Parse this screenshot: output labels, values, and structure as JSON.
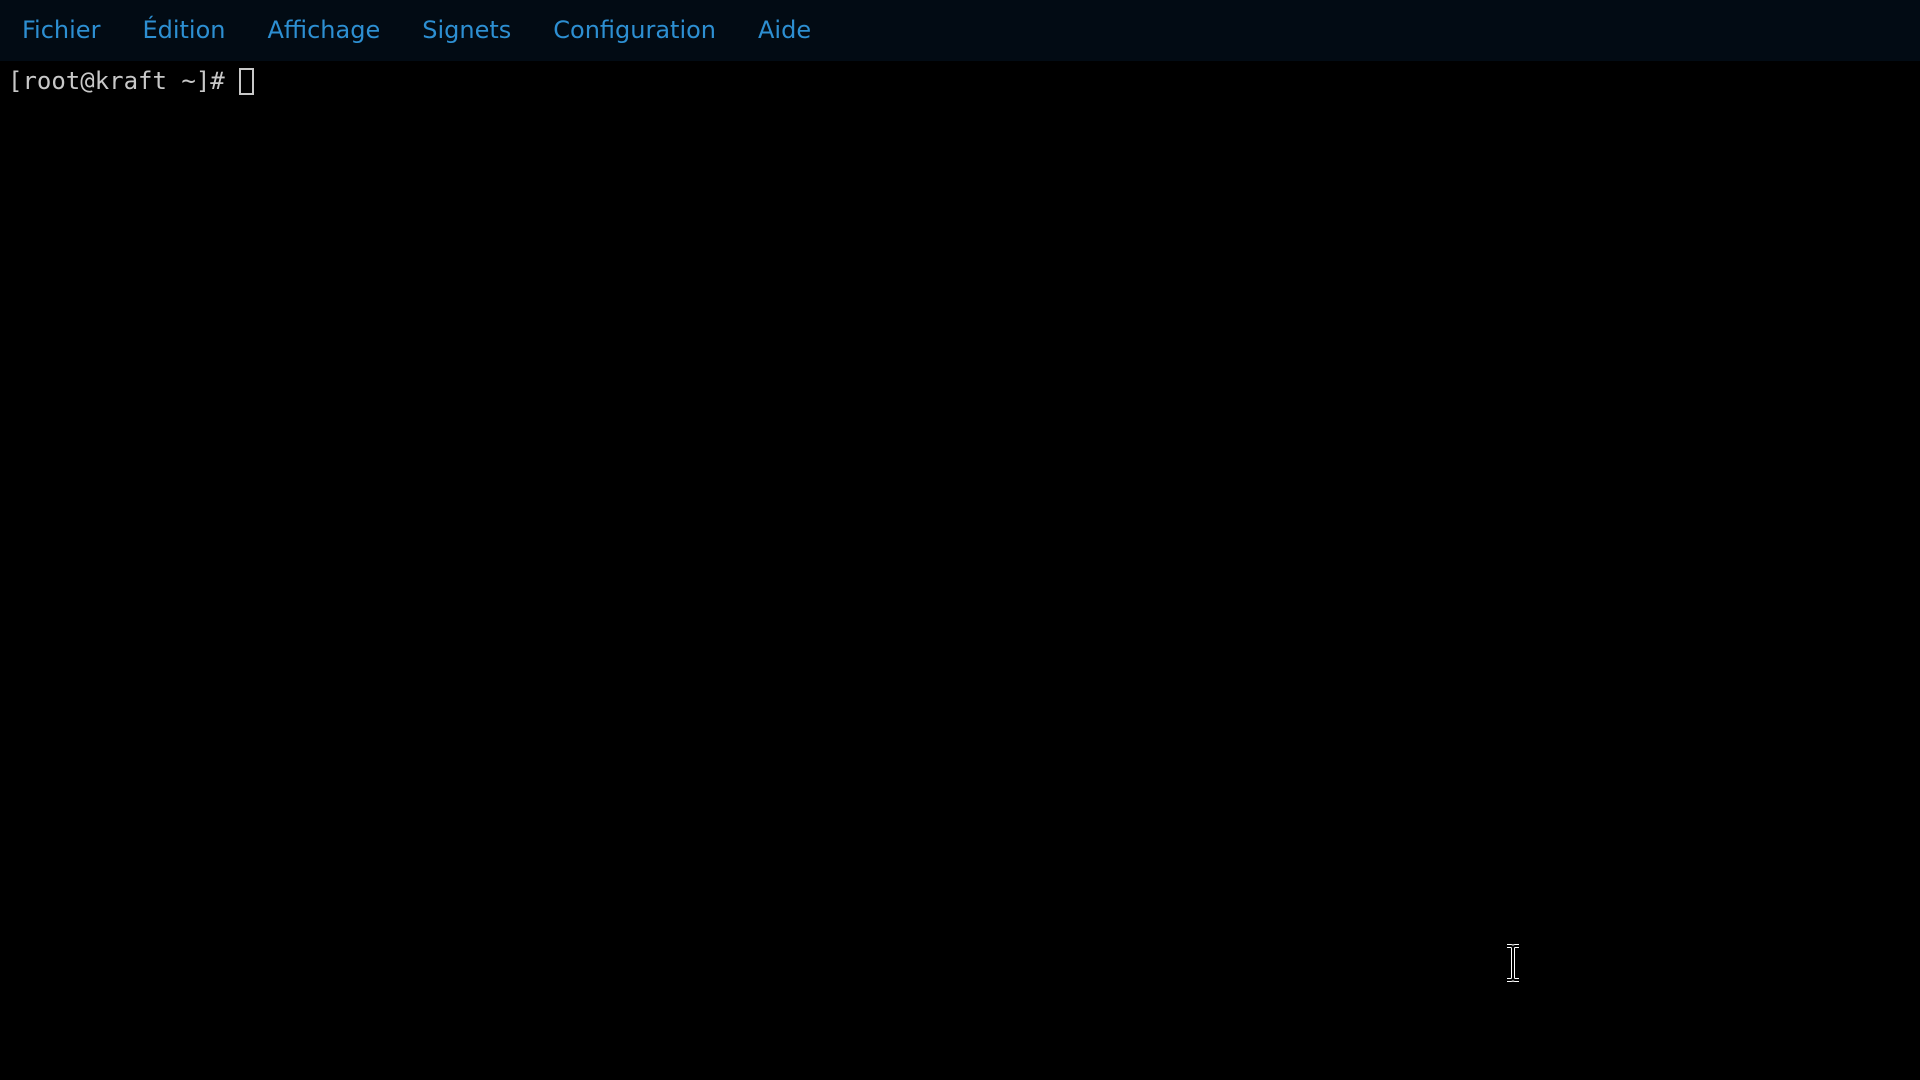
{
  "menubar": {
    "items": [
      {
        "label": "Fichier"
      },
      {
        "label": "Édition"
      },
      {
        "label": "Affichage"
      },
      {
        "label": "Signets"
      },
      {
        "label": "Configuration"
      },
      {
        "label": "Aide"
      }
    ]
  },
  "terminal": {
    "prompt": "[root@kraft ~]#",
    "input": ""
  },
  "colors": {
    "menubar_bg": "#020b14",
    "menu_text": "#2d8fd2",
    "terminal_bg": "#000000",
    "terminal_text": "#c8c8c8"
  },
  "icons": {
    "text_cursor": "ibeam-cursor-icon"
  }
}
